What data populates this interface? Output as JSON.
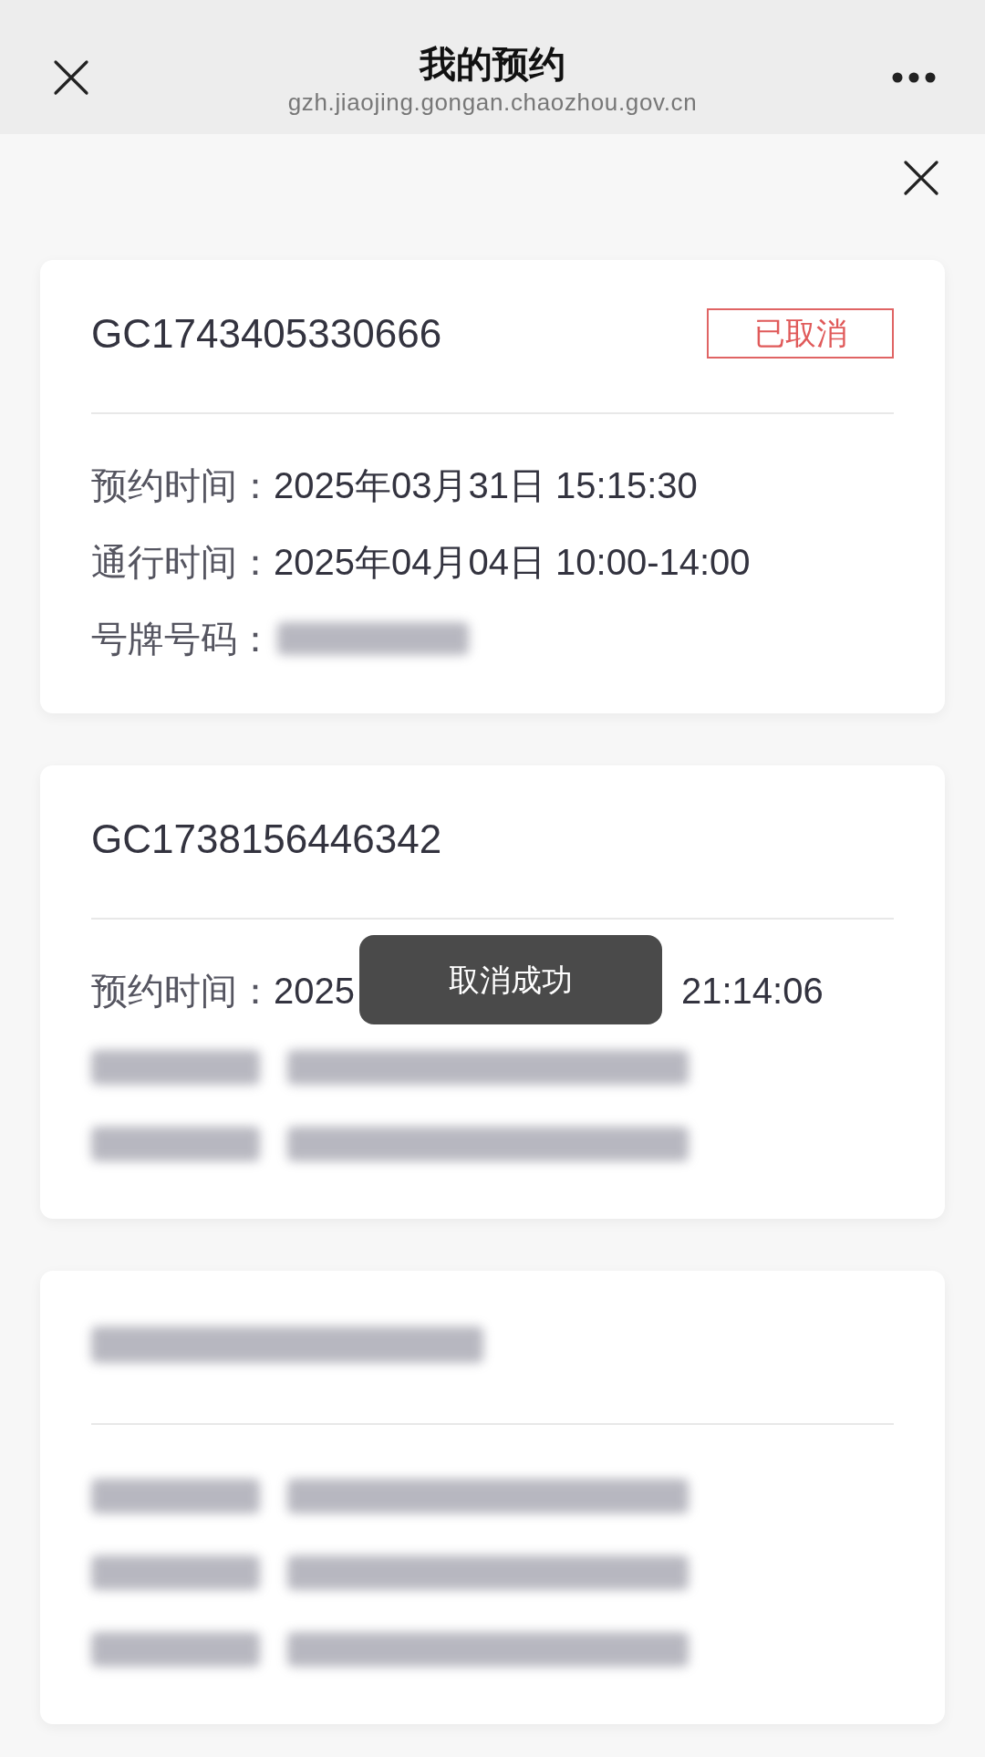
{
  "header": {
    "title": "我的预约",
    "url": "gzh.jiaojing.gongan.chaozhou.gov.cn"
  },
  "records": [
    {
      "kind": "normal",
      "id": "GC1743405330666",
      "status": "已取消",
      "fields": [
        {
          "kind": "text",
          "label": "预约时间：",
          "value": "2025年03月31日 15:15:30"
        },
        {
          "kind": "text",
          "label": "通行时间：",
          "value": "2025年04月04日 10:00-14:00"
        },
        {
          "kind": "blurred_value",
          "label": "号牌号码："
        }
      ]
    },
    {
      "kind": "normal",
      "id": "GC1738156446342",
      "fields": [
        {
          "kind": "split",
          "label": "预约时间：",
          "value_parts": [
            "2025",
            "21:14:06"
          ]
        },
        {
          "kind": "blurred"
        },
        {
          "kind": "blurred"
        }
      ]
    },
    {
      "kind": "blurred",
      "fields": [
        {
          "kind": "blurred"
        },
        {
          "kind": "blurred"
        },
        {
          "kind": "blurred"
        }
      ]
    }
  ],
  "toast": "取消成功"
}
